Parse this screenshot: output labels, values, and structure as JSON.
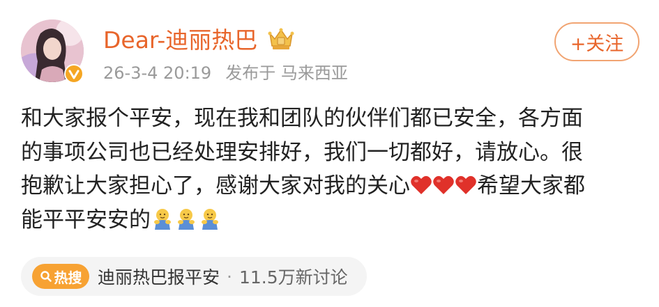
{
  "user": {
    "name": "Dear-迪丽热巴",
    "badge_icon": "crown-icon",
    "verified_icon": "verified-badge-icon"
  },
  "meta": {
    "time": "26-3-4 20:19",
    "location": "发布于 马来西亚"
  },
  "follow_button": {
    "label": "+关注"
  },
  "post": {
    "lines": [
      "和大家报个平安，现在我和团队的伙伴们都已安全，各方面",
      "的事项公司也已经处理安排好，我们一切都好，请放心。很",
      "抱歉让大家担心了，感谢大家对我的关心",
      "希望大家都",
      "能平平安安的"
    ],
    "emoji": {
      "heart": "heart-icon",
      "hug": "hug-icon",
      "heart_count": 3,
      "hug_count": 3
    }
  },
  "topic": {
    "badge": "热搜",
    "title": "迪丽热巴报平安",
    "separator": "·",
    "count": "11.5万新讨论"
  },
  "colors": {
    "accent": "#e8652b",
    "hot": "#f7a233",
    "heart": "#e0312a"
  }
}
